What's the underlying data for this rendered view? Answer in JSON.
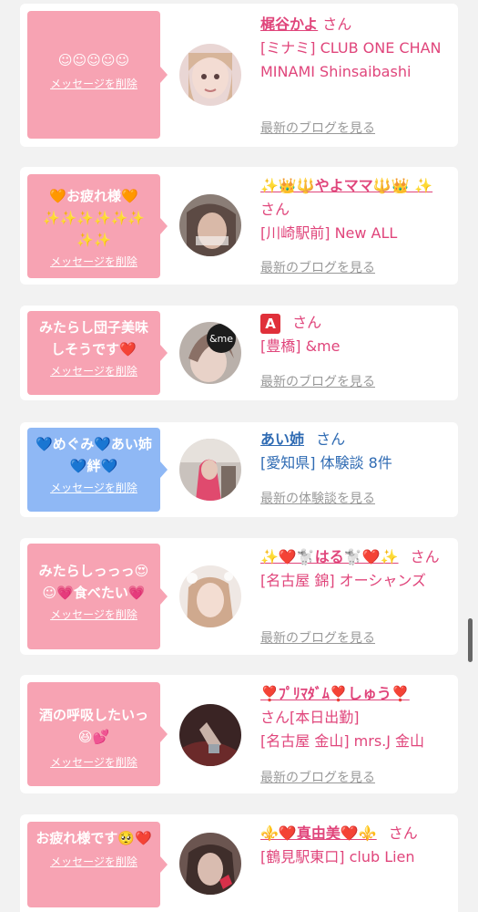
{
  "delete_label": "メッセージを削除",
  "cards": [
    {
      "message": "☺☺☺☺☺",
      "name": "梶谷かよ",
      "honorific": "さん",
      "shop": "[ミナミ] CLUB ONE CHAN MINAMI Shinsaibashi",
      "link": "最新のブログを見る"
    },
    {
      "message": "🧡お疲れ様🧡 ✨✨✨✨✨✨ ✨✨",
      "name": "✨👑🔱やよママ🔱👑 ✨",
      "honorific": "さん",
      "shop": "[川崎駅前] New ALL",
      "link": "最新のブログを見る"
    },
    {
      "message": "みたらし団子美味しそうです❤️",
      "name": "A",
      "honorific": "さん",
      "shop": "[豊橋] &me",
      "link": "最新のブログを見る"
    },
    {
      "message": "💙めぐみ💙あい姉💙絆💙",
      "name": "あい姉",
      "honorific": "さん",
      "shop": "[愛知県] 体験談 8件",
      "link": "最新の体験談を見る"
    },
    {
      "message": "みたらしっっっ😍☺💗食べたい💗",
      "name": "✨❤️🐩はる🐩❤️✨",
      "honorific": "さん",
      "shop": "[名古屋 錦] オーシャンズ",
      "link": "最新のブログを見る"
    },
    {
      "message": "酒の呼吸したいっ😆💕",
      "name": "❣️ﾌﾟﾘﾏﾀﾞﾑ❣️しゅう❣️",
      "honorific": "さん[本日出勤]",
      "shop": "[名古屋 金山] mrs.J 金山",
      "link": "最新のブログを見る"
    },
    {
      "message": "お疲れ様です🥺❤️",
      "name": "⚜️❤️真由美❤️⚜️",
      "honorific": "さん",
      "shop": "[鶴見駅東口] club Lien",
      "link": ""
    }
  ],
  "colors": {
    "pink_bubble": "#f7a3b3",
    "blue_bubble": "#8fb8f5",
    "pink_text": "#e0457b",
    "blue_text": "#2f6bb3"
  }
}
